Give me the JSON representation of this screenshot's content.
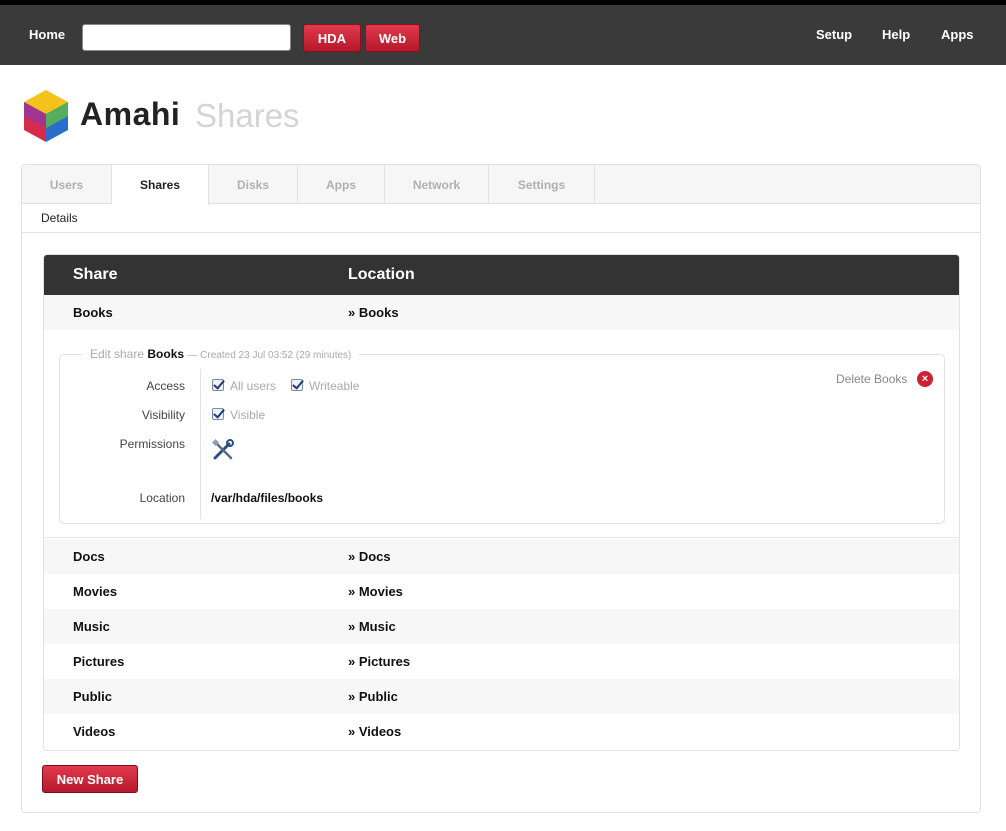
{
  "topbar": {
    "home": "Home",
    "search_value": "",
    "hda_button": "HDA",
    "web_button": "Web",
    "setup": "Setup",
    "help": "Help",
    "apps": "Apps"
  },
  "brand": {
    "name": "Amahi",
    "page_title": "Shares"
  },
  "tabs": [
    {
      "label": "Users"
    },
    {
      "label": "Shares"
    },
    {
      "label": "Disks"
    },
    {
      "label": "Apps"
    },
    {
      "label": "Network"
    },
    {
      "label": "Settings"
    }
  ],
  "subnav": {
    "details": "Details"
  },
  "table": {
    "headers": {
      "share": "Share",
      "location": "Location"
    },
    "rows": [
      {
        "share": "Books",
        "location": "» Books"
      },
      {
        "share": "Docs",
        "location": "» Docs"
      },
      {
        "share": "Movies",
        "location": "» Movies"
      },
      {
        "share": "Music",
        "location": "» Music"
      },
      {
        "share": "Pictures",
        "location": "» Pictures"
      },
      {
        "share": "Public",
        "location": "» Public"
      },
      {
        "share": "Videos",
        "location": "» Videos"
      }
    ]
  },
  "edit": {
    "legend_prefix": "Edit share",
    "share_name": "Books",
    "meta": "— Created 23 Jul 03:52 (29 minutes)",
    "access_label": "Access",
    "all_users": "All users",
    "writeable": "Writeable",
    "visibility_label": "Visibility",
    "visible": "Visible",
    "permissions_label": "Permissions",
    "location_label": "Location",
    "location_value": "/var/hda/files/books",
    "delete_label": "Delete Books",
    "delete_icon": "×"
  },
  "new_share_button": "New Share",
  "colors": {
    "accent_red": "#c8202f",
    "header_dark": "#333333",
    "topbar": "#3a3a3a"
  }
}
